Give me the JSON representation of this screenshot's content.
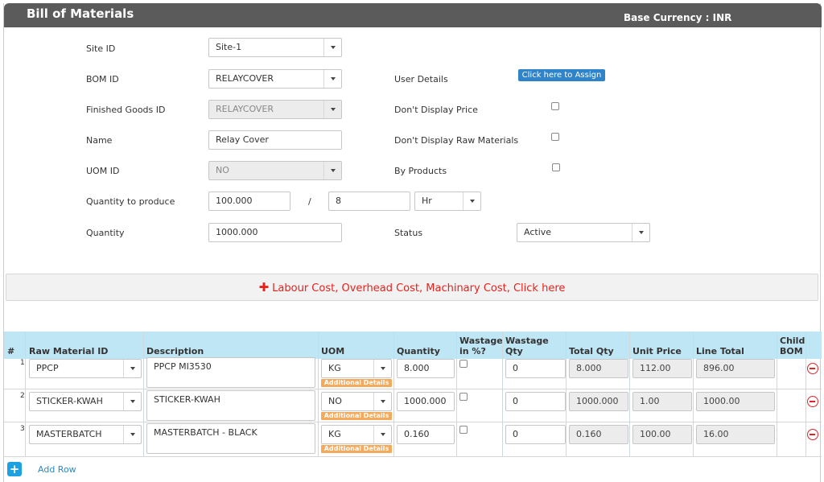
{
  "header": {
    "title": "Bill of Materials",
    "currency": "Base Currency : INR"
  },
  "form": {
    "site_id": {
      "label": "Site ID",
      "value": "Site-1"
    },
    "bom_id": {
      "label": "BOM ID",
      "value": "RELAYCOVER"
    },
    "finished_goods_id": {
      "label": "Finished Goods ID",
      "value": "RELAYCOVER"
    },
    "name": {
      "label": "Name",
      "value": "Relay Cover"
    },
    "uom_id": {
      "label": "UOM ID",
      "value": "NO"
    },
    "quantity_to_produce": {
      "label": "Quantity to produce",
      "value": "100.000",
      "separator": "/",
      "per_value": "8",
      "per_unit": "Hr"
    },
    "quantity": {
      "label": "Quantity",
      "value": "1000.000"
    },
    "user_details": {
      "label": "User Details",
      "button": "Click here to Assign"
    },
    "dont_display_price": {
      "label": "Don't Display Price"
    },
    "dont_display_raw": {
      "label": "Don't Display Raw Materials"
    },
    "by_products": {
      "label": "By Products"
    },
    "status": {
      "label": "Status",
      "value": "Active"
    }
  },
  "cost_bar": {
    "icon": "plus-icon",
    "label": "Labour Cost, Overhead Cost, Machinary Cost, Click here"
  },
  "grid": {
    "headers": {
      "num": "#",
      "raw_material_id": "Raw Material ID",
      "description": "Description",
      "uom": "UOM",
      "quantity": "Quantity",
      "wastage_pct_1": "Wastage",
      "wastage_pct_2": "in %?",
      "wastage_qty_1": "Wastage",
      "wastage_qty_2": "Qty",
      "total_qty": "Total Qty",
      "unit_price": "Unit Price",
      "line_total": "Line Total",
      "child_bom_1": "Child",
      "child_bom_2": "BOM"
    },
    "additional_label": "Additional Details",
    "rows": [
      {
        "num": "1",
        "raw_material_id": "PPCP",
        "description": "PPCP MI3530",
        "uom": "KG",
        "quantity": "8.000",
        "wastage_qty": "0",
        "total_qty": "8.000",
        "unit_price": "112.00",
        "line_total": "896.00"
      },
      {
        "num": "2",
        "raw_material_id": "STICKER-KWAH",
        "description": "STICKER-KWAH",
        "uom": "NO",
        "quantity": "1000.000",
        "wastage_qty": "0",
        "total_qty": "1000.000",
        "unit_price": "1.00",
        "line_total": "1000.00"
      },
      {
        "num": "3",
        "raw_material_id": "MASTERBATCH",
        "description": "MASTERBATCH - BLACK",
        "uom": "KG",
        "quantity": "0.160",
        "wastage_qty": "0",
        "total_qty": "0.160",
        "unit_price": "100.00",
        "line_total": "16.00"
      }
    ]
  },
  "add_row": {
    "label": "Add Row"
  }
}
